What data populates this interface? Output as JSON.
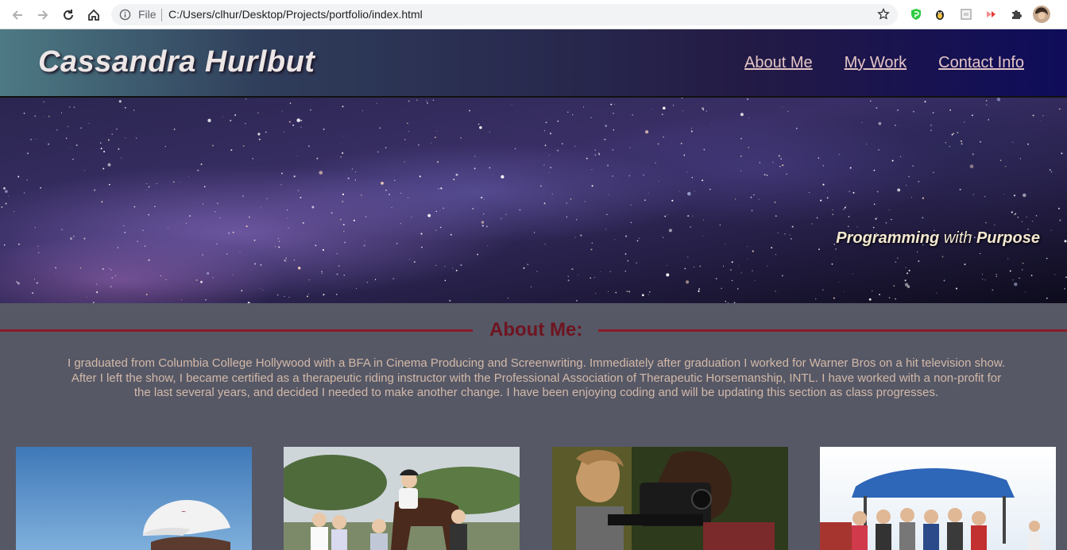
{
  "browser": {
    "file_label": "File",
    "url": "C:/Users/clhur/Desktop/Projects/portfolio/index.html",
    "icons": [
      "back-icon",
      "forward-icon",
      "reload-icon",
      "home-icon",
      "info-icon",
      "star-icon",
      "extension-icons",
      "puzzle-icon",
      "profile-avatar"
    ]
  },
  "header": {
    "title": "Cassandra Hurlbut",
    "nav": [
      "About Me",
      "My Work",
      "Contact Info"
    ]
  },
  "hero": {
    "tagline_part1": "Programming",
    "tagline_part2": "with",
    "tagline_part3": "Purpose"
  },
  "about": {
    "heading": "About Me:",
    "text": "I graduated from Columbia College Hollywood with a BFA in Cinema Producing and Screenwriting. Immediately after graduation I worked for Warner Bros on a hit television show. After I left the show, I became certified as a therapeutic riding instructor with the Professional Association of Therapeutic Horsemanship, INTL. I have worked with a non-profit for the last several years, and decided I needed to make another change. I have been enjoying coding and will be updating this section as class progresses."
  },
  "colors": {
    "accent_line": "#8b1c26",
    "nav_link": "#e5c6c6",
    "page_bg": "#565866"
  }
}
